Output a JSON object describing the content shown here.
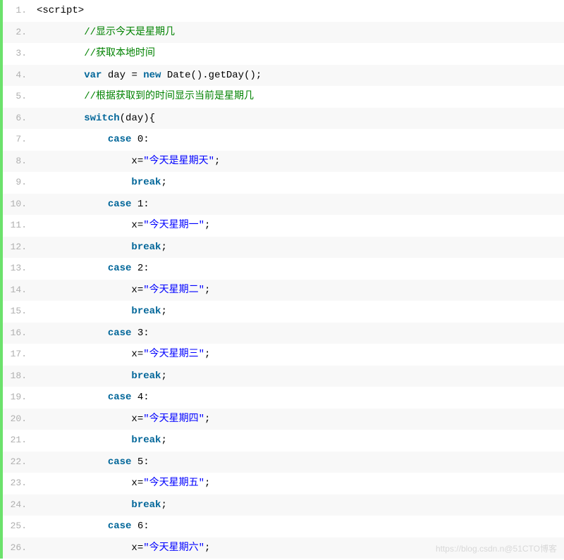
{
  "watermark": "https://blog.csdn.n@51CTO博客",
  "lines": [
    {
      "n": "1.",
      "alt": false,
      "indent": 0,
      "tokens": [
        [
          "plain",
          "<script>"
        ]
      ]
    },
    {
      "n": "2.",
      "alt": true,
      "indent": 2,
      "tokens": [
        [
          "comment",
          "//显示今天是星期几"
        ]
      ]
    },
    {
      "n": "3.",
      "alt": false,
      "indent": 2,
      "tokens": [
        [
          "comment",
          "//获取本地时间"
        ]
      ]
    },
    {
      "n": "4.",
      "alt": true,
      "indent": 2,
      "tokens": [
        [
          "keyword",
          "var"
        ],
        [
          "plain",
          " day = "
        ],
        [
          "keyword",
          "new"
        ],
        [
          "plain",
          " Date().getDay();"
        ]
      ]
    },
    {
      "n": "5.",
      "alt": false,
      "indent": 2,
      "tokens": [
        [
          "comment",
          "//根据获取到的时间显示当前是星期几"
        ]
      ]
    },
    {
      "n": "6.",
      "alt": true,
      "indent": 2,
      "tokens": [
        [
          "keyword",
          "switch"
        ],
        [
          "plain",
          "(day){"
        ]
      ]
    },
    {
      "n": "7.",
      "alt": false,
      "indent": 3,
      "tokens": [
        [
          "keyword",
          "case"
        ],
        [
          "plain",
          " 0:"
        ]
      ]
    },
    {
      "n": "8.",
      "alt": true,
      "indent": 4,
      "tokens": [
        [
          "plain",
          "x="
        ],
        [
          "string",
          "\"今天是星期天\""
        ],
        [
          "plain",
          ";"
        ]
      ]
    },
    {
      "n": "9.",
      "alt": false,
      "indent": 4,
      "tokens": [
        [
          "keyword",
          "break"
        ],
        [
          "plain",
          ";"
        ]
      ]
    },
    {
      "n": "10.",
      "alt": true,
      "indent": 3,
      "tokens": [
        [
          "keyword",
          "case"
        ],
        [
          "plain",
          " 1:"
        ]
      ]
    },
    {
      "n": "11.",
      "alt": false,
      "indent": 4,
      "tokens": [
        [
          "plain",
          "x="
        ],
        [
          "string",
          "\"今天星期一\""
        ],
        [
          "plain",
          ";"
        ]
      ]
    },
    {
      "n": "12.",
      "alt": true,
      "indent": 4,
      "tokens": [
        [
          "keyword",
          "break"
        ],
        [
          "plain",
          ";"
        ]
      ]
    },
    {
      "n": "13.",
      "alt": false,
      "indent": 3,
      "tokens": [
        [
          "keyword",
          "case"
        ],
        [
          "plain",
          " 2:"
        ]
      ]
    },
    {
      "n": "14.",
      "alt": true,
      "indent": 4,
      "tokens": [
        [
          "plain",
          "x="
        ],
        [
          "string",
          "\"今天星期二\""
        ],
        [
          "plain",
          ";"
        ]
      ]
    },
    {
      "n": "15.",
      "alt": false,
      "indent": 4,
      "tokens": [
        [
          "keyword",
          "break"
        ],
        [
          "plain",
          ";"
        ]
      ]
    },
    {
      "n": "16.",
      "alt": true,
      "indent": 3,
      "tokens": [
        [
          "keyword",
          "case"
        ],
        [
          "plain",
          " 3:"
        ]
      ]
    },
    {
      "n": "17.",
      "alt": false,
      "indent": 4,
      "tokens": [
        [
          "plain",
          "x="
        ],
        [
          "string",
          "\"今天星期三\""
        ],
        [
          "plain",
          ";"
        ]
      ]
    },
    {
      "n": "18.",
      "alt": true,
      "indent": 4,
      "tokens": [
        [
          "keyword",
          "break"
        ],
        [
          "plain",
          ";"
        ]
      ]
    },
    {
      "n": "19.",
      "alt": false,
      "indent": 3,
      "tokens": [
        [
          "keyword",
          "case"
        ],
        [
          "plain",
          " 4:"
        ]
      ]
    },
    {
      "n": "20.",
      "alt": true,
      "indent": 4,
      "tokens": [
        [
          "plain",
          "x="
        ],
        [
          "string",
          "\"今天星期四\""
        ],
        [
          "plain",
          ";"
        ]
      ]
    },
    {
      "n": "21.",
      "alt": false,
      "indent": 4,
      "tokens": [
        [
          "keyword",
          "break"
        ],
        [
          "plain",
          ";"
        ]
      ]
    },
    {
      "n": "22.",
      "alt": true,
      "indent": 3,
      "tokens": [
        [
          "keyword",
          "case"
        ],
        [
          "plain",
          " 5:"
        ]
      ]
    },
    {
      "n": "23.",
      "alt": false,
      "indent": 4,
      "tokens": [
        [
          "plain",
          "x="
        ],
        [
          "string",
          "\"今天星期五\""
        ],
        [
          "plain",
          ";"
        ]
      ]
    },
    {
      "n": "24.",
      "alt": true,
      "indent": 4,
      "tokens": [
        [
          "keyword",
          "break"
        ],
        [
          "plain",
          ";"
        ]
      ]
    },
    {
      "n": "25.",
      "alt": false,
      "indent": 3,
      "tokens": [
        [
          "keyword",
          "case"
        ],
        [
          "plain",
          " 6:"
        ]
      ]
    },
    {
      "n": "26.",
      "alt": true,
      "indent": 4,
      "tokens": [
        [
          "plain",
          "x="
        ],
        [
          "string",
          "\"今天星期六\""
        ],
        [
          "plain",
          ";"
        ]
      ]
    }
  ]
}
